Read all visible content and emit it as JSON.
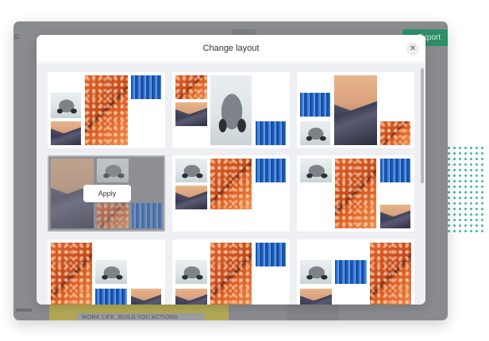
{
  "background_app": {
    "export_label": "Export",
    "bottom_doc_text": "WORK LIFE, BUILD YOU ACTIONS"
  },
  "modal": {
    "title": "Change layout",
    "close_glyph": "✕",
    "apply_label": "Apply"
  },
  "layouts": [
    {
      "name": "layout-1"
    },
    {
      "name": "layout-2"
    },
    {
      "name": "layout-3"
    },
    {
      "name": "layout-4",
      "hovered": true
    },
    {
      "name": "layout-5"
    },
    {
      "name": "layout-6"
    },
    {
      "name": "layout-7"
    },
    {
      "name": "layout-8"
    },
    {
      "name": "layout-9"
    }
  ],
  "icons": {
    "home": "home-icon",
    "close": "close-icon"
  },
  "colors": {
    "accent_green": "#2c8f66",
    "dot_teal": "#3fb5a8",
    "overlay_gray": "#8a8b8f"
  }
}
